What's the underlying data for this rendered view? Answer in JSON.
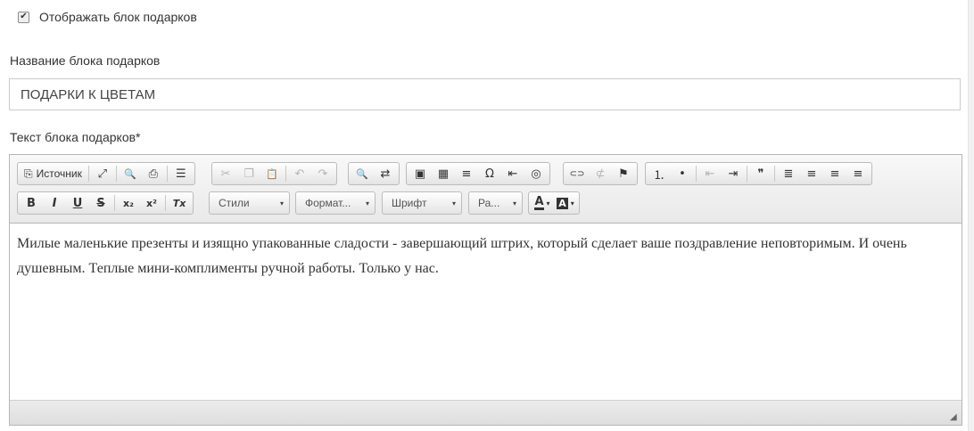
{
  "show_gifts": {
    "label": "Отображать блок подарков",
    "checked": true,
    "check_mark": "✔"
  },
  "gift_title": {
    "label": "Название блока подарков",
    "value": "ПОДАРКИ К ЦВЕТАМ"
  },
  "gift_text": {
    "label": "Текст блока подарков*",
    "content": "Милые маленькие презенты и изящно упакованные сладости - завершающий штрих, который сделает ваше поздравление неповторимым. И очень душевным. Теплые мини-комплименты ручной работы. Только у нас."
  },
  "toolbar": {
    "source_label": "Источник",
    "combos": {
      "styles": "Стили",
      "format": "Формат...",
      "font": "Шрифт",
      "size": "Ра..."
    },
    "glyphs": {
      "source": "⎘",
      "maximize": "⤢",
      "preview": "🔍",
      "print": "⎙",
      "templates": "☰",
      "cut": "✂",
      "copy": "❐",
      "paste": "📋",
      "undo": "↶",
      "redo": "↷",
      "find": "🔍",
      "replace": "⇄",
      "image": "▣",
      "table": "▦",
      "hline": "≡",
      "special_char": "Ω",
      "pagebreak": "⇤",
      "iframe": "◎",
      "link": "⊂⊃",
      "unlink": "⊄",
      "anchor": "⚑",
      "numbered_list": "⒈",
      "bullet_list": "•",
      "outdent": "⇤",
      "indent": "⇥",
      "blockquote": "❞",
      "align_justify": "≣",
      "align_center": "≡",
      "align_left": "≡",
      "align_right": "≡",
      "bold": "B",
      "italic": "I",
      "underline": "U",
      "strike": "S",
      "subscript": "x₂",
      "superscript": "x²",
      "remove_format": "Tx",
      "text_color": "A",
      "bg_color": "A",
      "dropdown_arrow": "▾",
      "resize_grip": "◢"
    }
  }
}
